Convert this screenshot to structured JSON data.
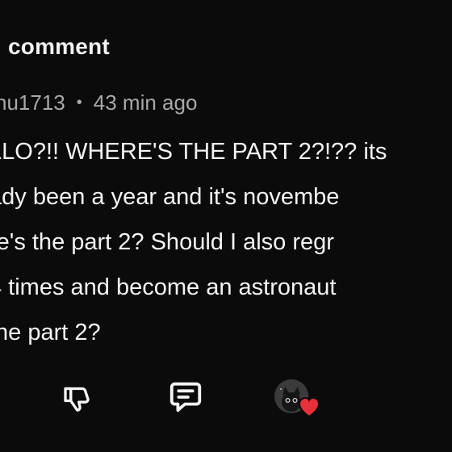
{
  "header": {
    "title": "comment"
  },
  "comment": {
    "author": "nu1713",
    "separator": "•",
    "timestamp": "43 min ago",
    "lines": [
      "LLO?!! WHERE'S THE PART 2?!?? its",
      "ady been a year and it's novembe",
      "re's the part 2? Should I also regr",
      "4 times and become an astronaut",
      "the part 2?"
    ]
  },
  "actions": {
    "dislike_icon": "thumbs-down-icon",
    "reply_icon": "comment-icon",
    "creator_heart_icon": "heart-icon"
  },
  "colors": {
    "background": "#0b0b0b",
    "text": "#f1f1f1",
    "muted": "#a9a9a9",
    "heart": "#e8303a"
  }
}
